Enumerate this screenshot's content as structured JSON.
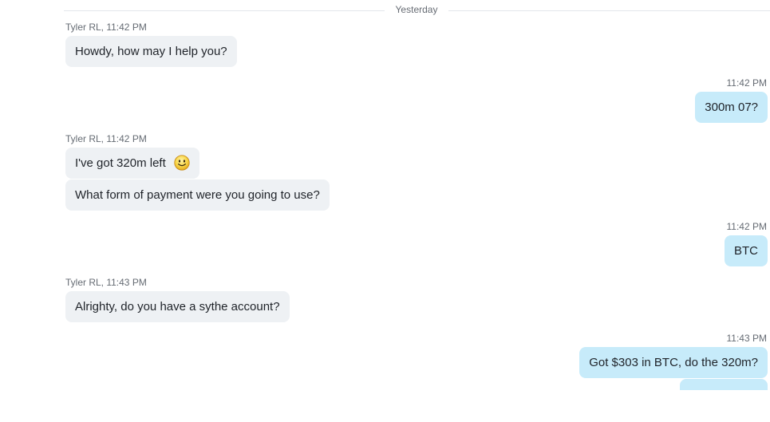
{
  "day_divider": "Yesterday",
  "messages": [
    {
      "direction": "in",
      "meta": "Tyler RL, 11:42 PM",
      "bubbles": [
        "Howdy, how may I help you?"
      ]
    },
    {
      "direction": "out",
      "meta": "11:42 PM",
      "bubbles": [
        "300m 07?"
      ]
    },
    {
      "direction": "in",
      "meta": "Tyler RL, 11:42 PM",
      "bubbles": [
        "I've got 320m left",
        "What form of payment were you going to use?"
      ],
      "emoji": "smile-emoji-icon"
    },
    {
      "direction": "out",
      "meta": "11:42 PM",
      "bubbles": [
        "BTC"
      ]
    },
    {
      "direction": "in",
      "meta": "Tyler RL, 11:43 PM",
      "bubbles": [
        "Alrighty, do you have a sythe account?"
      ]
    },
    {
      "direction": "out",
      "meta": "11:43 PM",
      "bubbles": [
        "Got $303 in BTC, do the 320m?"
      ]
    }
  ],
  "colors": {
    "incoming_bubble": "#eef1f4",
    "outgoing_bubble": "#c7ebfa",
    "meta_text": "#656b73"
  }
}
